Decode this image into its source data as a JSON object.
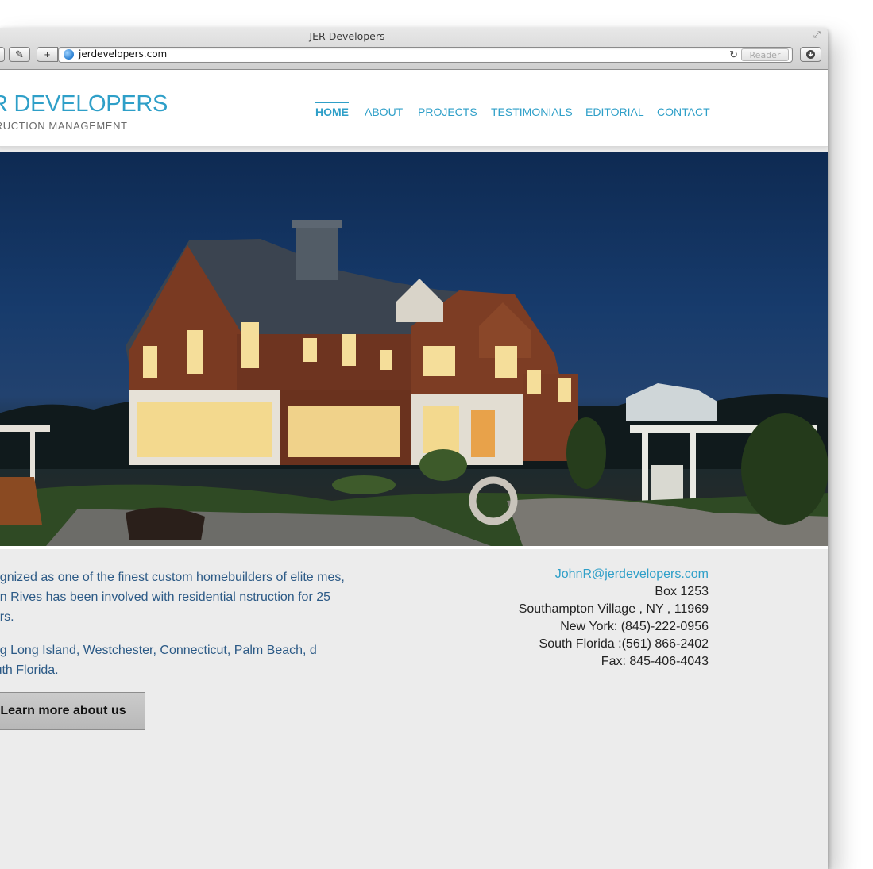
{
  "window": {
    "title": "JER Developers",
    "url": "jerdevelopers.com",
    "reader_label": "Reader",
    "add_label": "+",
    "tools_label": "✎"
  },
  "header": {
    "logo_main": "ER DEVELOPERS",
    "logo_sub": "NSTRUCTION MANAGEMENT",
    "nav": [
      {
        "label": "HOME",
        "active": true
      },
      {
        "label": "ABOUT"
      },
      {
        "label": "PROJECTS"
      },
      {
        "label": "TESTIMONIALS"
      },
      {
        "label": "EDITORIAL"
      },
      {
        "label": "CONTACT"
      }
    ]
  },
  "hero": {
    "icon": "house-night-photo"
  },
  "intro": {
    "paragraph1": "ecognized as one of the finest custom homebuilders of elite mes, John Rives has been involved with residential nstruction for 25 years.",
    "paragraph2": "rving Long Island, Westchester, Connecticut, Palm Beach, d South Florida.",
    "button_label": "Learn more about us"
  },
  "contact": {
    "email": "JohnR@jerdevelopers.com",
    "box": "Box 1253",
    "address": "Southampton Village , NY , 11969",
    "ny_phone": "New York: (845)-222-0956",
    "fl_phone": "South Florida :(561) 866-2402",
    "fax": "Fax: 845-406-4043"
  },
  "colors": {
    "accent": "#2e9fc8",
    "body_text": "#2c5a86",
    "page_bg": "#ececec"
  }
}
